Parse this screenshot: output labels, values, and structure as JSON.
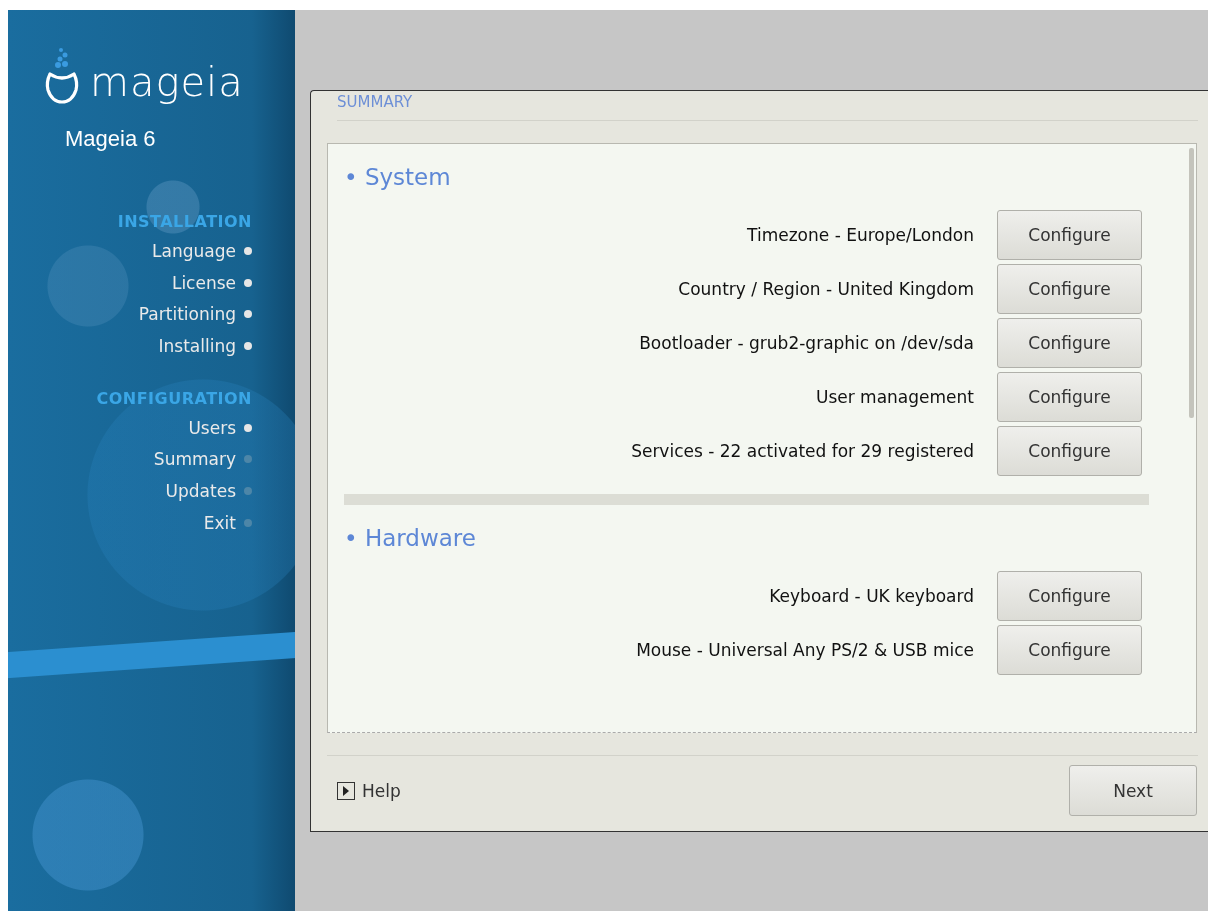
{
  "sidebar": {
    "logo_text": "mageia",
    "product": "Mageia 6",
    "groups": [
      {
        "title": "INSTALLATION",
        "steps": [
          {
            "label": "Language",
            "done": true
          },
          {
            "label": "License",
            "done": true
          },
          {
            "label": "Partitioning",
            "done": true
          },
          {
            "label": "Installing",
            "done": true
          }
        ]
      },
      {
        "title": "CONFIGURATION",
        "steps": [
          {
            "label": "Users",
            "done": true
          },
          {
            "label": "Summary",
            "done": false
          },
          {
            "label": "Updates",
            "done": false
          },
          {
            "label": "Exit",
            "done": false
          }
        ]
      }
    ]
  },
  "dialog": {
    "title": "SUMMARY",
    "sections": [
      {
        "heading": "• System",
        "items": [
          {
            "label": "Timezone - Europe/London",
            "button": "Configure"
          },
          {
            "label": "Country / Region - United Kingdom",
            "button": "Configure"
          },
          {
            "label": "Bootloader - grub2-graphic on /dev/sda",
            "button": "Configure"
          },
          {
            "label": "User management",
            "button": "Configure"
          },
          {
            "label": "Services - 22 activated for 29 registered",
            "button": "Configure"
          }
        ]
      },
      {
        "heading": "• Hardware",
        "items": [
          {
            "label": "Keyboard - UK keyboard",
            "button": "Configure"
          },
          {
            "label": "Mouse - Universal Any PS/2 & USB mice",
            "button": "Configure"
          }
        ]
      }
    ],
    "help": "Help",
    "next": "Next"
  }
}
